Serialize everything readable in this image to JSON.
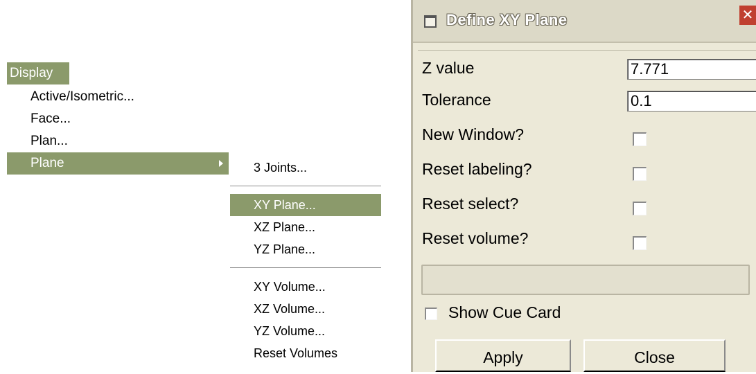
{
  "menu": {
    "header": "Display",
    "items": [
      "Active/Isometric...",
      "Face...",
      "Plan...",
      "Plane"
    ],
    "active_index": 3
  },
  "submenu": {
    "group1": [
      "3 Joints..."
    ],
    "group2": [
      "XY Plane...",
      "XZ Plane...",
      "YZ Plane..."
    ],
    "group3": [
      "XY Volume...",
      "XZ Volume...",
      "YZ Volume...",
      "Reset Volumes"
    ],
    "highlighted": "XY Plane..."
  },
  "dialog": {
    "title": "Define XY Plane",
    "close_glyph": "✕",
    "z_value": {
      "label": "Z value",
      "value": "7.771"
    },
    "tolerance": {
      "label": "Tolerance",
      "value": "0.1"
    },
    "checkboxes": [
      {
        "label": "New Window?",
        "checked": false
      },
      {
        "label": "Reset labeling?",
        "checked": false
      },
      {
        "label": "Reset select?",
        "checked": false
      },
      {
        "label": "Reset volume?",
        "checked": false
      }
    ],
    "show_cue_card": {
      "label": "Show Cue Card",
      "checked": false
    },
    "apply_label": "Apply",
    "close_label": "Close"
  },
  "colors": {
    "menu_highlight": "#8b9a6b",
    "dialog_bg": "#ece9d8"
  }
}
